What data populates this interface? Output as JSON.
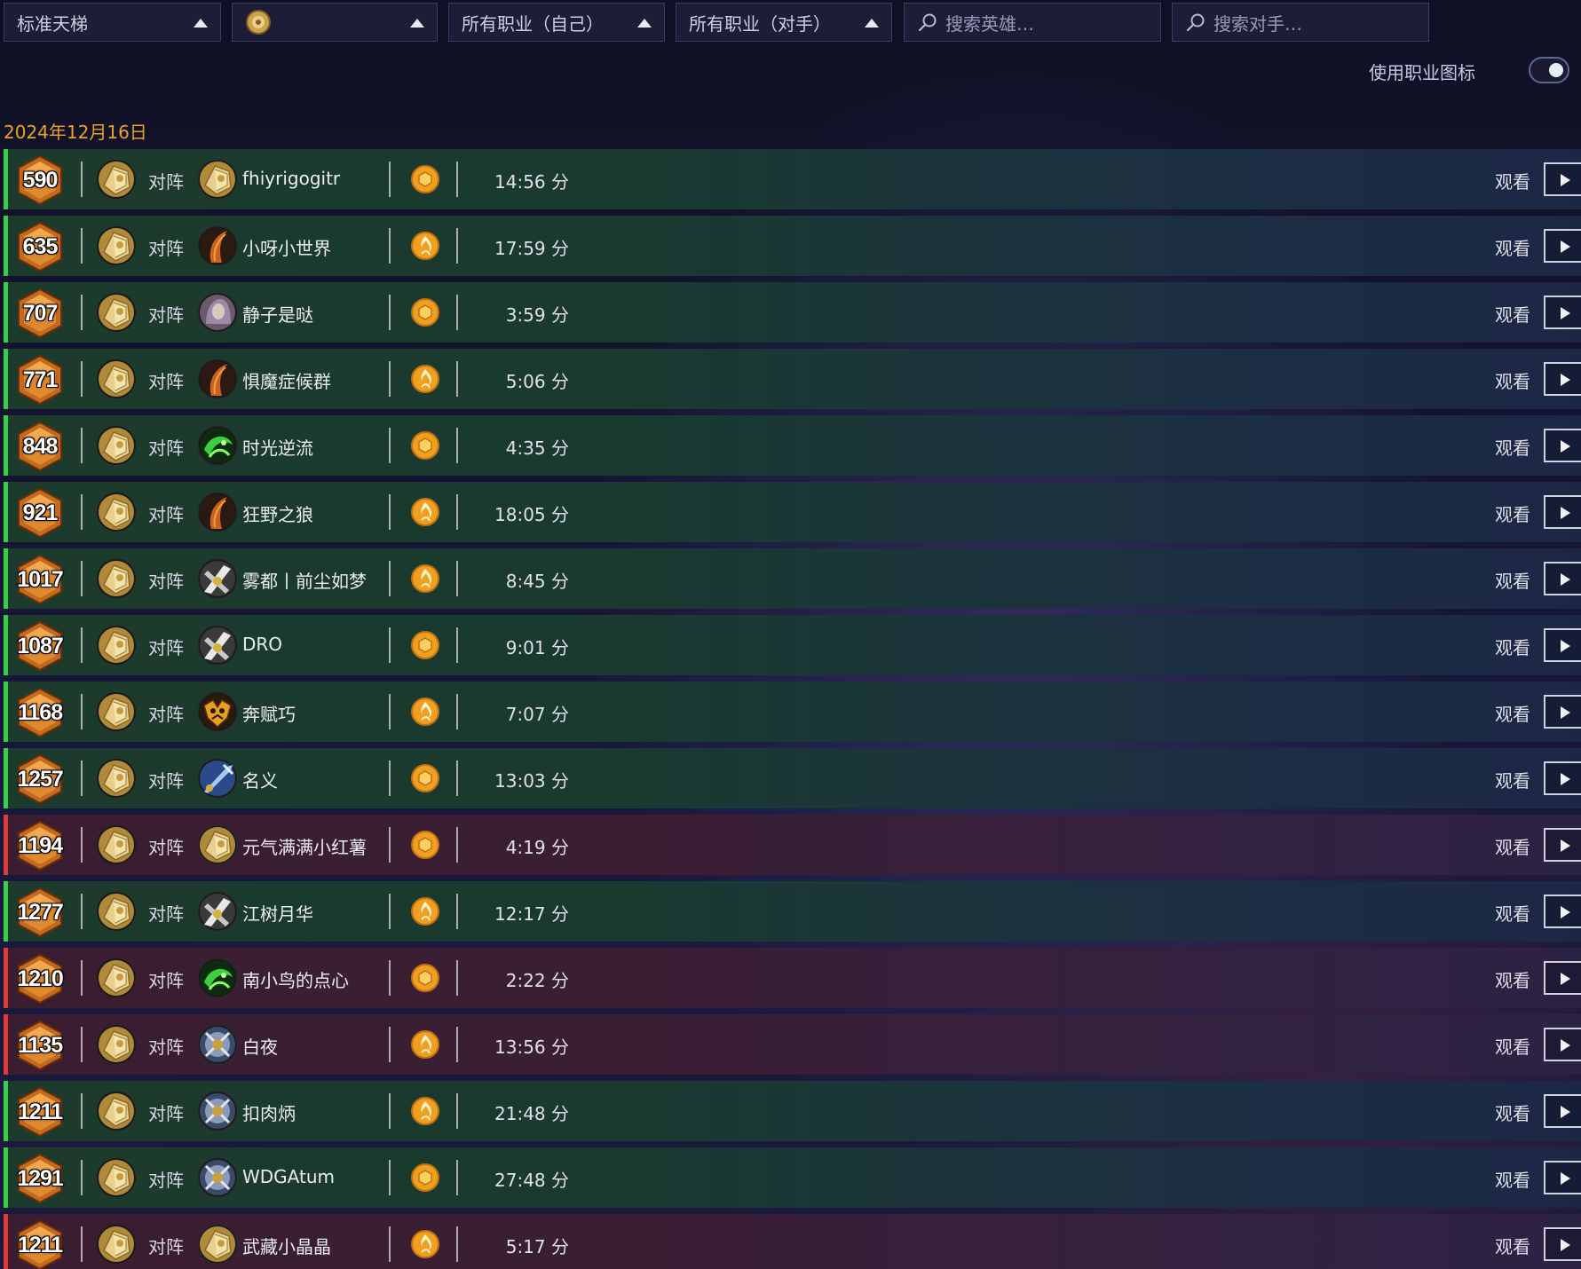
{
  "filters": {
    "mode": "标准天梯",
    "mode_icon": "gold-mode-icon",
    "class_self": "所有职业（自己）",
    "class_opponent": "所有职业（对手）",
    "search_hero_placeholder": "搜索英雄…",
    "search_opponent_placeholder": "搜索对手…"
  },
  "toggle": {
    "label": "使用职业图标",
    "on": true
  },
  "date": "2024年12月16日",
  "colors": {
    "win": "#35d04a",
    "loss": "#e03a3a",
    "date": "#e8a12a",
    "coin": "#f0a020"
  },
  "vs_label": "对阵",
  "watch_label": "观看",
  "matches": [
    {
      "rank": "590",
      "result": "win",
      "opponent": "fhiyrigogitr",
      "opponent_hero": "paladin-hero-icon",
      "coin": "coin-icon",
      "duration": "14:56 分"
    },
    {
      "rank": "635",
      "result": "win",
      "opponent": "小呀小世界",
      "opponent_hero": "rogue-hero-icon",
      "coin": "flame-coin-icon",
      "duration": "17:59 分"
    },
    {
      "rank": "707",
      "result": "win",
      "opponent": "静子是哒",
      "opponent_hero": "priest-hero-icon",
      "coin": "coin-icon",
      "duration": "3:59 分"
    },
    {
      "rank": "771",
      "result": "win",
      "opponent": "惧魔症候群",
      "opponent_hero": "rogue-hero-icon",
      "coin": "flame-coin-icon",
      "duration": "5:06 分"
    },
    {
      "rank": "848",
      "result": "win",
      "opponent": "时光逆流",
      "opponent_hero": "demon-hunter-hero-icon",
      "coin": "coin-icon",
      "duration": "4:35 分"
    },
    {
      "rank": "921",
      "result": "win",
      "opponent": "狂野之狼",
      "opponent_hero": "rogue-hero-icon",
      "coin": "flame-coin-icon",
      "duration": "18:05 分"
    },
    {
      "rank": "1017",
      "result": "win",
      "opponent": "雾都丨前尘如梦",
      "opponent_hero": "warrior-hero-icon",
      "coin": "flame-coin-icon",
      "duration": "8:45 分"
    },
    {
      "rank": "1087",
      "result": "win",
      "opponent": "DRO",
      "opponent_hero": "warrior-hero-icon",
      "coin": "coin-icon",
      "duration": "9:01 分"
    },
    {
      "rank": "1168",
      "result": "win",
      "opponent": "奔赋巧",
      "opponent_hero": "warlock-hero-icon",
      "coin": "flame-coin-icon",
      "duration": "7:07 分"
    },
    {
      "rank": "1257",
      "result": "win",
      "opponent": "名义",
      "opponent_hero": "mage-hero-icon",
      "coin": "coin-icon",
      "duration": "13:03 分"
    },
    {
      "rank": "1194",
      "result": "loss",
      "opponent": "元气满满小红薯",
      "opponent_hero": "paladin-hero-icon",
      "coin": "coin-icon",
      "duration": "4:19 分"
    },
    {
      "rank": "1277",
      "result": "win",
      "opponent": "江树月华",
      "opponent_hero": "warrior-hero-icon",
      "coin": "flame-coin-icon",
      "duration": "12:17 分"
    },
    {
      "rank": "1210",
      "result": "loss",
      "opponent": "南小鸟的点心",
      "opponent_hero": "demon-hunter-hero-icon",
      "coin": "coin-icon",
      "duration": "2:22 分"
    },
    {
      "rank": "1135",
      "result": "loss",
      "opponent": "白夜",
      "opponent_hero": "death-knight-hero-icon",
      "coin": "flame-coin-icon",
      "duration": "13:56 分"
    },
    {
      "rank": "1211",
      "result": "win",
      "opponent": "扣肉炳",
      "opponent_hero": "death-knight-hero-icon",
      "coin": "flame-coin-icon",
      "duration": "21:48 分"
    },
    {
      "rank": "1291",
      "result": "win",
      "opponent": "WDGAtum",
      "opponent_hero": "death-knight-hero-icon",
      "coin": "coin-icon",
      "duration": "27:48 分"
    },
    {
      "rank": "1211",
      "result": "loss",
      "opponent": "武藏小晶晶",
      "opponent_hero": "paladin-hero-icon",
      "coin": "flame-coin-icon",
      "duration": "5:17 分"
    }
  ]
}
